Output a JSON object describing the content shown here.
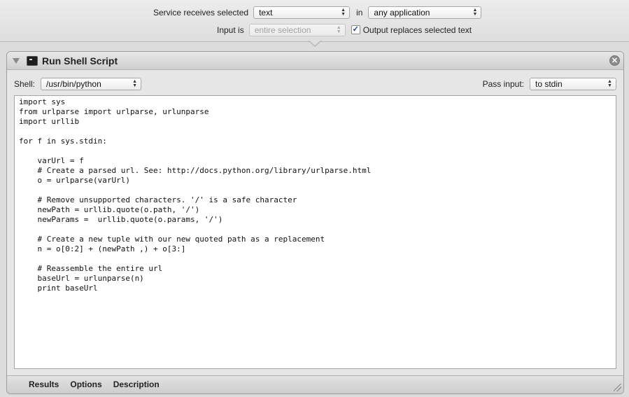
{
  "service": {
    "receives_label": "Service receives selected",
    "receives_value": "text",
    "in_label": "in",
    "application_value": "any application",
    "input_is_label": "Input is",
    "input_is_value": "entire selection",
    "output_replaces_label": "Output replaces selected text",
    "output_replaces_checked": true
  },
  "action": {
    "title": "Run Shell Script",
    "shell_label": "Shell:",
    "shell_value": "/usr/bin/python",
    "pass_input_label": "Pass input:",
    "pass_input_value": "to stdin",
    "code": "import sys\nfrom urlparse import urlparse, urlunparse\nimport urllib\n\nfor f in sys.stdin:\n\n    varUrl = f\n    # Create a parsed url. See: http://docs.python.org/library/urlparse.html\n    o = urlparse(varUrl)\n\n    # Remove unsupported characters. '/' is a safe character\n    newPath = urllib.quote(o.path, '/')\n    newParams =  urllib.quote(o.params, '/')\n\n    # Create a new tuple with our new quoted path as a replacement\n    n = o[0:2] + (newPath ,) + o[3:]\n\n    # Reassemble the entire url\n    baseUrl = urlunparse(n)\n    print baseUrl"
  },
  "footer": {
    "tabs": [
      {
        "label": "Results"
      },
      {
        "label": "Options"
      },
      {
        "label": "Description"
      }
    ]
  },
  "icons": {
    "disclosure": "disclosure-triangle-icon",
    "terminal": "terminal-icon",
    "close": "close-icon",
    "checkmark": "checkmark-icon",
    "popup_arrows": "up-down-arrows-icon",
    "resize": "resize-grip-icon"
  }
}
